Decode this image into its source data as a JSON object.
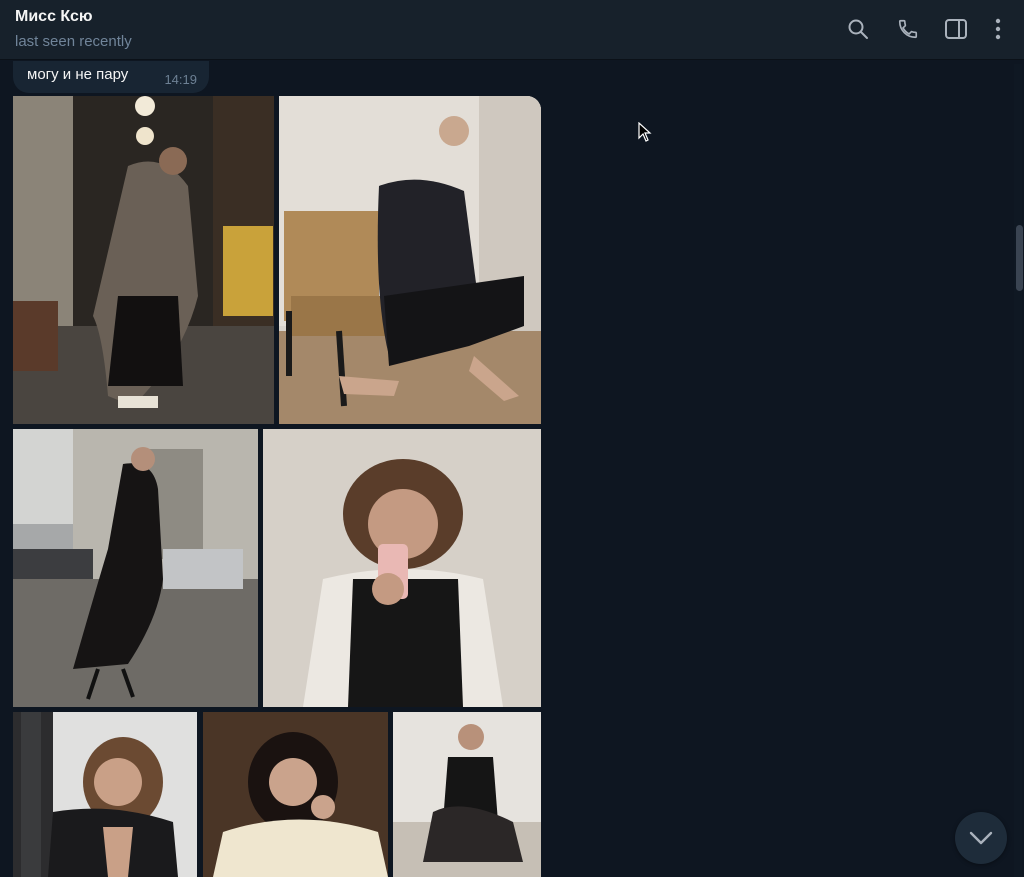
{
  "header": {
    "contact_name": "Мисс Ксю",
    "status": "last seen recently",
    "icons": [
      "search-icon",
      "phone-icon",
      "sidebar-toggle-icon",
      "more-vertical-icon"
    ]
  },
  "message": {
    "text": "могу и не пару",
    "time": "14:19"
  },
  "album": {
    "photo_count": 7
  },
  "colors": {
    "background": "#0e1621",
    "header": "#17212b",
    "bubble": "#182533",
    "secondary_text": "#708499"
  }
}
